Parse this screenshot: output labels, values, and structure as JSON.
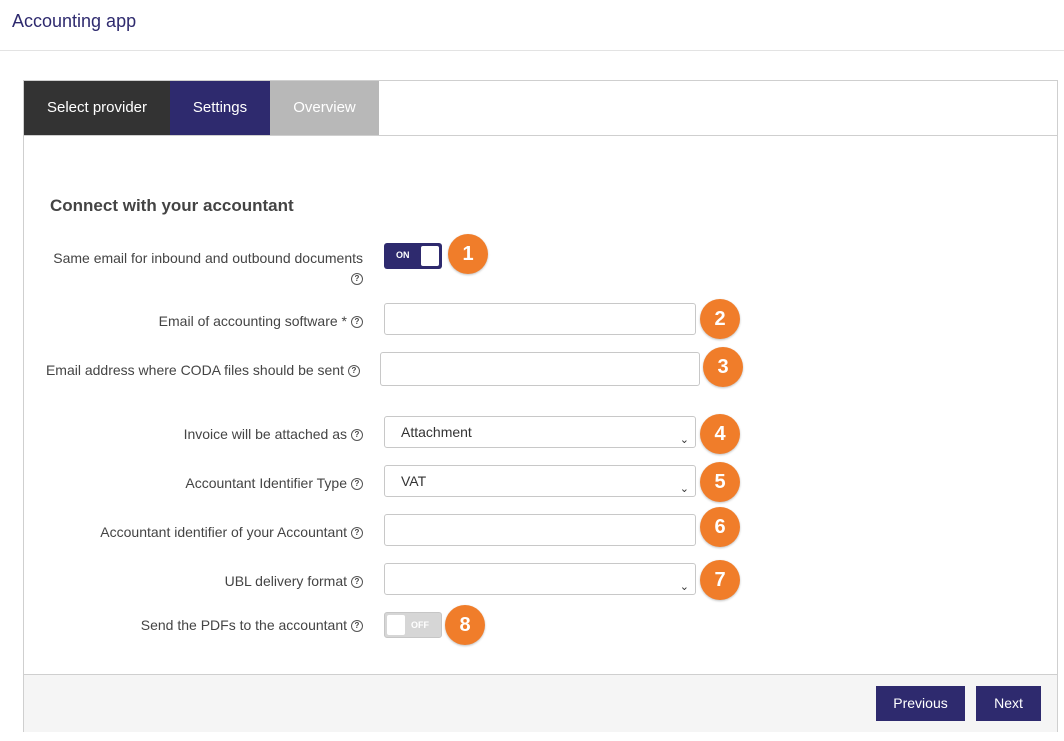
{
  "app": {
    "title": "Accounting app"
  },
  "tabs": [
    {
      "label": "Select provider"
    },
    {
      "label": "Settings"
    },
    {
      "label": "Overview"
    }
  ],
  "section": {
    "heading": "Connect with your accountant"
  },
  "help_glyph": "?",
  "fields": {
    "same_email": {
      "label_line1": "Same email for inbound and outbound documents",
      "toggle": "ON",
      "checked": true,
      "marker": "1"
    },
    "accounting_email": {
      "label": "Email of accounting software *",
      "value": "",
      "marker": "2"
    },
    "coda_email": {
      "label": "Email address where CODA files should be sent",
      "value": "",
      "marker": "3"
    },
    "invoice_attached": {
      "label": "Invoice will be attached as",
      "selected": "Attachment",
      "marker": "4"
    },
    "identifier_type": {
      "label": "Accountant Identifier Type",
      "selected": "VAT",
      "marker": "5"
    },
    "identifier": {
      "label": "Accountant identifier of your Accountant",
      "value": "",
      "marker": "6"
    },
    "ubl_format": {
      "label": "UBL delivery format",
      "selected": "",
      "marker": "7"
    },
    "send_pdfs": {
      "label": "Send the PDFs to the accountant",
      "toggle": "OFF",
      "checked": false,
      "marker": "8"
    }
  },
  "footer": {
    "previous": "Previous",
    "next": "Next"
  },
  "colors": {
    "primary": "#2e2a6e",
    "dark_tab": "#333333",
    "inactive_tab": "#b8b8b8",
    "marker": "#f07d2a"
  },
  "icons": {
    "help": "question-circle-icon",
    "dropdown": "chevron-down-icon"
  }
}
